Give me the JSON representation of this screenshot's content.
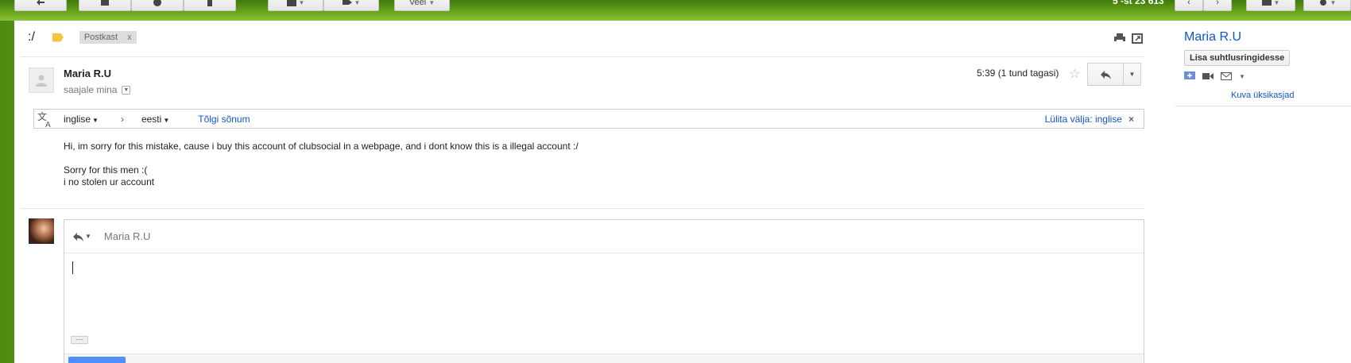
{
  "toolbar": {
    "more_label": "Veel",
    "count_text": "5 -st 23 613"
  },
  "thread": {
    "subject": ":/",
    "label_chip": "Postkast",
    "label_chip_close": "x"
  },
  "message": {
    "sender": "Maria R.U",
    "recipient": "saajale mina",
    "time": "5:39 (1 tund tagasi)",
    "body_lines": [
      "Hi, im sorry for this mistake, cause i buy this account of clubsocial in a webpage, and i dont know this is a illegal account :/",
      "Sorry for this men :(",
      "i no stolen ur account"
    ]
  },
  "translate": {
    "source_lang": "inglise",
    "target_lang": "eesti",
    "translate_link": "Tõlgi sõnum",
    "turn_off": "Lülita välja: inglise",
    "close": "×"
  },
  "compose": {
    "to": "Maria R.U",
    "more_dots": "···"
  },
  "contact": {
    "name": "Maria R.U",
    "add_circles": "Lisa suhtlusringidesse",
    "show_similar": "Kuva üksikasjad"
  },
  "icons": [
    "back-icon",
    "archive-icon",
    "spam-icon",
    "delete-icon",
    "folder-icon",
    "label-icon",
    "print-icon",
    "new-window-icon",
    "reply-icon",
    "star-icon",
    "translate-icon",
    "chat-icon",
    "video-icon",
    "mail-icon",
    "gear-icon",
    "keyboard-icon"
  ],
  "colors": {
    "link": "#1155cc",
    "label_tag": "#f4c542",
    "send_button": "#4d90fe"
  }
}
